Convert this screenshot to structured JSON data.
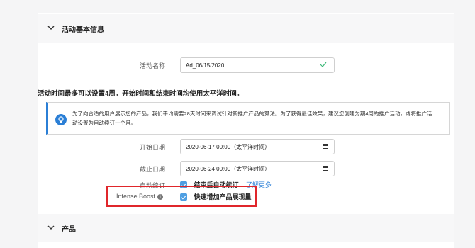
{
  "section_basic": {
    "title": "活动基本信息"
  },
  "campaign_name": {
    "label": "活动名称",
    "value": "Ad_06/15/2020"
  },
  "duration_note": "活动时间最多可以设置4周。开始时间和结束时间均使用太平洋时间。",
  "info": {
    "text_line1": "为了向合适的用户展示您的产品，我们平均需要28天时间来调试针对新推广产品的算法。为了获得最佳效果，建议您创建为期4周的推广活动，或将推广活",
    "text_line2": "动设置为自动续订一个月。"
  },
  "start_date": {
    "label": "开始日期",
    "value": "2020-06-17 00:00（太平洋时间）"
  },
  "end_date": {
    "label": "截止日期",
    "value": "2020-06-24 00:00（太平洋时间）"
  },
  "auto_renew": {
    "label": "自动续订",
    "checkbox_label": "结束后自动续订",
    "link": "了解更多"
  },
  "intense_boost": {
    "label": "Intense Boost",
    "checkbox_label": "快速增加产品展现量"
  },
  "section_products": {
    "title": "产品"
  },
  "colors": {
    "accent": "#2b7fd6",
    "highlight": "#e0262b",
    "check": "#4f9fe2",
    "valid": "#3cb878"
  }
}
